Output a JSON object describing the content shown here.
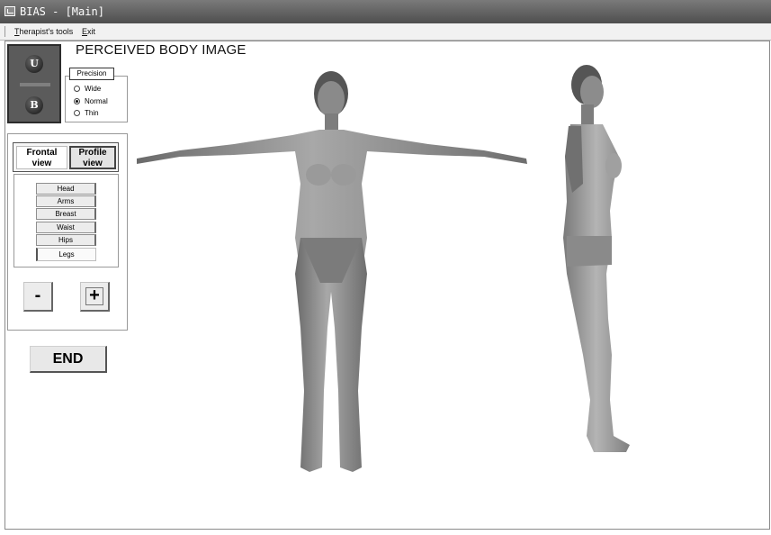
{
  "window": {
    "title": "BIAS - [Main]"
  },
  "menu": [
    {
      "label": "Therapist's tools",
      "underline": "T",
      "rest": "herapist's tools"
    },
    {
      "label": "Exit",
      "underline": "E",
      "rest": "xit"
    }
  ],
  "main": {
    "heading": "PERCEIVED BODY IMAGE"
  },
  "ub": {
    "upper_label": "U",
    "lower_label": "B"
  },
  "precision": {
    "label": "Precision",
    "options": [
      {
        "label": "Wide",
        "selected": false
      },
      {
        "label": "Normal",
        "selected": true
      },
      {
        "label": "Thin",
        "selected": false
      }
    ]
  },
  "views": {
    "frontal": "Frontal view",
    "frontal_l1": "Frontal",
    "frontal_l2": "view",
    "profile": "Profile view",
    "profile_l1": "Profile",
    "profile_l2": "view",
    "active": "Profile view"
  },
  "body_parts": [
    "Head",
    "Arms",
    "Breast",
    "Waist",
    "Hips",
    "Legs"
  ],
  "selected_part": "Legs",
  "controls": {
    "minus": "-",
    "plus": "+",
    "end": "END"
  }
}
